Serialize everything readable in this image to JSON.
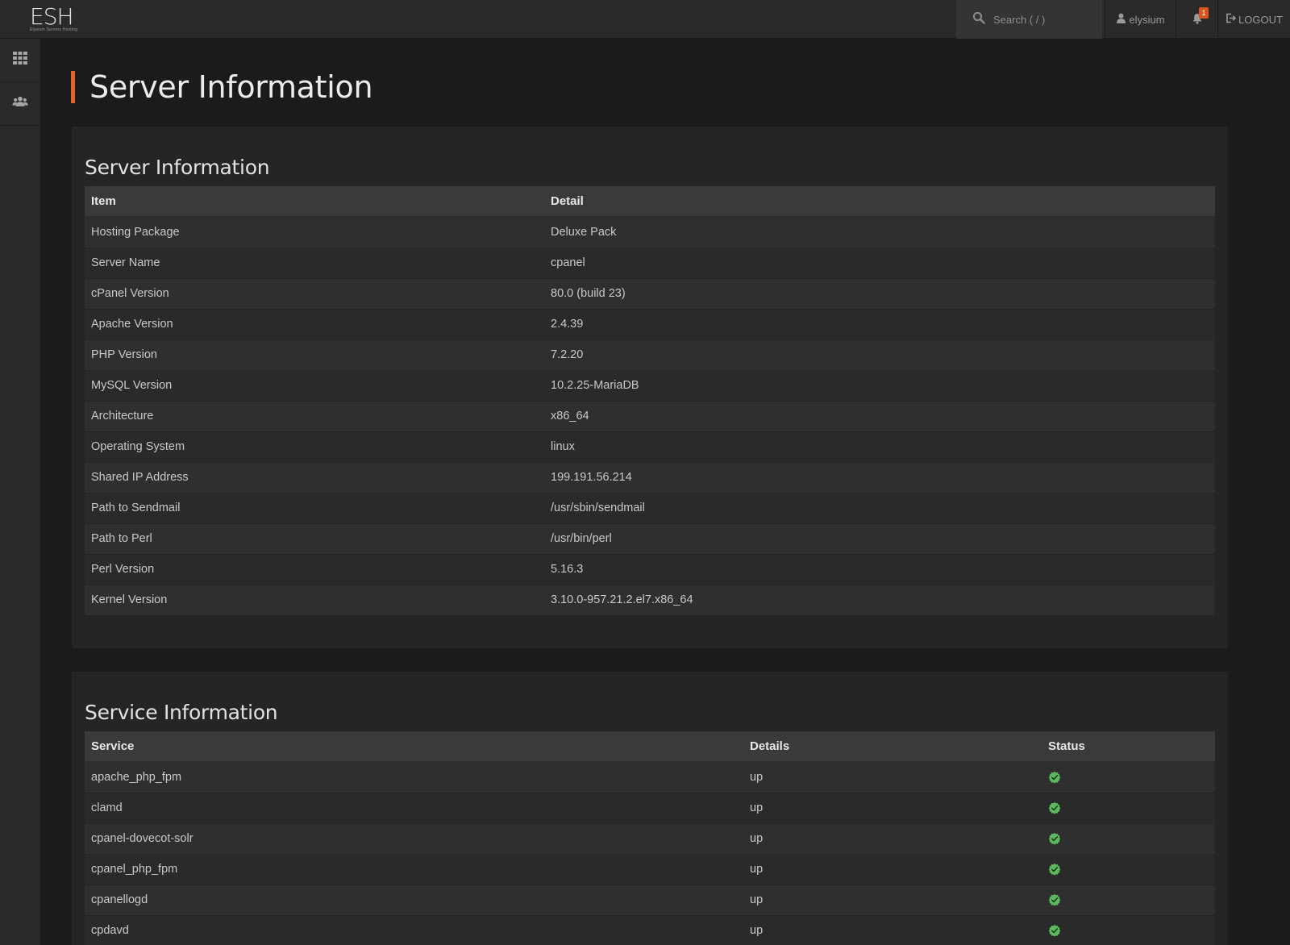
{
  "header": {
    "logo_text": "ESH",
    "logo_tagline": "Elysium Servers Hosting",
    "search_placeholder": "Search ( / )",
    "user_name": "elysium",
    "notification_count": "1",
    "logout_label": "LOGOUT"
  },
  "sidebar": {
    "items": [
      {
        "icon": "grid-icon"
      },
      {
        "icon": "users-icon"
      }
    ]
  },
  "page": {
    "title": "Server Information"
  },
  "server_info": {
    "heading": "Server Information",
    "columns": [
      "Item",
      "Detail"
    ],
    "rows": [
      {
        "item": "Hosting Package",
        "detail": "Deluxe Pack"
      },
      {
        "item": "Server Name",
        "detail": "cpanel"
      },
      {
        "item": "cPanel Version",
        "detail": "80.0 (build 23)"
      },
      {
        "item": "Apache Version",
        "detail": "2.4.39"
      },
      {
        "item": "PHP Version",
        "detail": "7.2.20"
      },
      {
        "item": "MySQL Version",
        "detail": "10.2.25-MariaDB"
      },
      {
        "item": "Architecture",
        "detail": "x86_64"
      },
      {
        "item": "Operating System",
        "detail": "linux"
      },
      {
        "item": "Shared IP Address",
        "detail": "199.191.56.214"
      },
      {
        "item": "Path to Sendmail",
        "detail": "/usr/sbin/sendmail"
      },
      {
        "item": "Path to Perl",
        "detail": "/usr/bin/perl"
      },
      {
        "item": "Perl Version",
        "detail": "5.16.3"
      },
      {
        "item": "Kernel Version",
        "detail": "3.10.0-957.21.2.el7.x86_64"
      }
    ]
  },
  "service_info": {
    "heading": "Service Information",
    "columns": [
      "Service",
      "Details",
      "Status"
    ],
    "rows": [
      {
        "service": "apache_php_fpm",
        "details": "up",
        "status": "ok"
      },
      {
        "service": "clamd",
        "details": "up",
        "status": "ok"
      },
      {
        "service": "cpanel-dovecot-solr",
        "details": "up",
        "status": "ok"
      },
      {
        "service": "cpanel_php_fpm",
        "details": "up",
        "status": "ok"
      },
      {
        "service": "cpanellogd",
        "details": "up",
        "status": "ok"
      },
      {
        "service": "cpdavd",
        "details": "up",
        "status": "ok"
      }
    ]
  },
  "colors": {
    "accent": "#e8622c",
    "status_ok": "#5cb85c"
  }
}
